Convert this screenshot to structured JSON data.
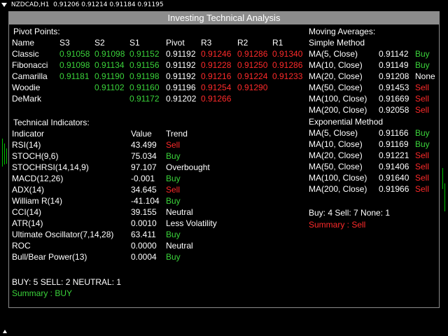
{
  "chart": {
    "symbol": "NZDCAD,H1",
    "prices": "0.91206 0.91214 0.91184 0.91195"
  },
  "panel": {
    "title": "Investing Technical Analysis",
    "pivot": {
      "heading": "Pivot Points:",
      "headers": [
        "Name",
        "S3",
        "S2",
        "S1",
        "Pivot",
        "R3",
        "R2",
        "R1"
      ],
      "rows": [
        {
          "name": "Classic",
          "s3": "0.91058",
          "s2": "0.91098",
          "s1": "0.91152",
          "pivot": "0.91192",
          "r3": "0.91246",
          "r2": "0.91286",
          "r1": "0.91340"
        },
        {
          "name": "Fibonacci",
          "s3": "0.91098",
          "s2": "0.91134",
          "s1": "0.91156",
          "pivot": "0.91192",
          "r3": "0.91228",
          "r2": "0.91250",
          "r1": "0.91286"
        },
        {
          "name": "Camarilla",
          "s3": "0.91181",
          "s2": "0.91190",
          "s1": "0.91198",
          "pivot": "0.91192",
          "r3": "0.91216",
          "r2": "0.91224",
          "r1": "0.91233"
        },
        {
          "name": "Woodie",
          "s3": "",
          "s2": "0.91102",
          "s1": "0.91160",
          "pivot": "0.91196",
          "r3": "0.91254",
          "r2": "0.91290",
          "r1": ""
        },
        {
          "name": "DeMark",
          "s3": "",
          "s2": "",
          "s1": "0.91172",
          "pivot": "0.91202",
          "r3": "0.91266",
          "r2": "",
          "r1": ""
        }
      ]
    },
    "indicators": {
      "heading": "Technical Indicators:",
      "headers": [
        "Indicator",
        "Value",
        "Trend"
      ],
      "rows": [
        {
          "name": "RSI(14)",
          "value": "43.499",
          "trend": "Sell",
          "color": "#ff2a2a"
        },
        {
          "name": "STOCH(9,6)",
          "value": "75.034",
          "trend": "Buy",
          "color": "#3ad33a"
        },
        {
          "name": "STOCHRSI(14,14,9)",
          "value": "97.107",
          "trend": "Overbought",
          "color": "#ffffff"
        },
        {
          "name": "MACD(12,26)",
          "value": "-0.001",
          "trend": "Buy",
          "color": "#3ad33a"
        },
        {
          "name": "ADX(14)",
          "value": "34.645",
          "trend": "Sell",
          "color": "#ff2a2a"
        },
        {
          "name": "William R(14)",
          "value": "-41.104",
          "trend": "Buy",
          "color": "#3ad33a"
        },
        {
          "name": "CCI(14)",
          "value": "39.155",
          "trend": "Neutral",
          "color": "#ffffff"
        },
        {
          "name": "ATR(14)",
          "value": "0.0010",
          "trend": "Less Volatility",
          "color": "#ffffff"
        },
        {
          "name": "Ultimate Oscillator(7,14,28)",
          "value": "63.411",
          "trend": "Buy",
          "color": "#3ad33a"
        },
        {
          "name": "ROC",
          "value": "0.0000",
          "trend": "Neutral",
          "color": "#ffffff"
        },
        {
          "name": "Bull/Bear Power(13)",
          "value": "0.0004",
          "trend": "Buy",
          "color": "#3ad33a"
        }
      ],
      "counts": "BUY: 5   SELL: 2   NEUTRAL: 1",
      "summary": "Summary : BUY"
    },
    "ma": {
      "heading": "Moving Averages:",
      "simple_heading": "Simple Method",
      "simple": [
        {
          "name": "MA(5, Close)",
          "value": "0.91142",
          "signal": "Buy",
          "color": "#3ad33a"
        },
        {
          "name": "MA(10, Close)",
          "value": "0.91149",
          "signal": "Buy",
          "color": "#3ad33a"
        },
        {
          "name": "MA(20, Close)",
          "value": "0.91208",
          "signal": "None",
          "color": "#ffffff"
        },
        {
          "name": "MA(50, Close)",
          "value": "0.91453",
          "signal": "Sell",
          "color": "#ff2a2a"
        },
        {
          "name": "MA(100, Close)",
          "value": "0.91669",
          "signal": "Sell",
          "color": "#ff2a2a"
        },
        {
          "name": "MA(200, Close)",
          "value": "0.92058",
          "signal": "Sell",
          "color": "#ff2a2a"
        }
      ],
      "exp_heading": "Exponential Method",
      "exponential": [
        {
          "name": "MA(5, Close)",
          "value": "0.91166",
          "signal": "Buy",
          "color": "#3ad33a"
        },
        {
          "name": "MA(10, Close)",
          "value": "0.91169",
          "signal": "Buy",
          "color": "#3ad33a"
        },
        {
          "name": "MA(20, Close)",
          "value": "0.91221",
          "signal": "Sell",
          "color": "#ff2a2a"
        },
        {
          "name": "MA(50, Close)",
          "value": "0.91406",
          "signal": "Sell",
          "color": "#ff2a2a"
        },
        {
          "name": "MA(100, Close)",
          "value": "0.91640",
          "signal": "Sell",
          "color": "#ff2a2a"
        },
        {
          "name": "MA(200, Close)",
          "value": "0.91966",
          "signal": "Sell",
          "color": "#ff2a2a"
        }
      ],
      "counts": "Buy: 4  Sell: 7  None: 1",
      "summary": "Summary : Sell"
    }
  }
}
